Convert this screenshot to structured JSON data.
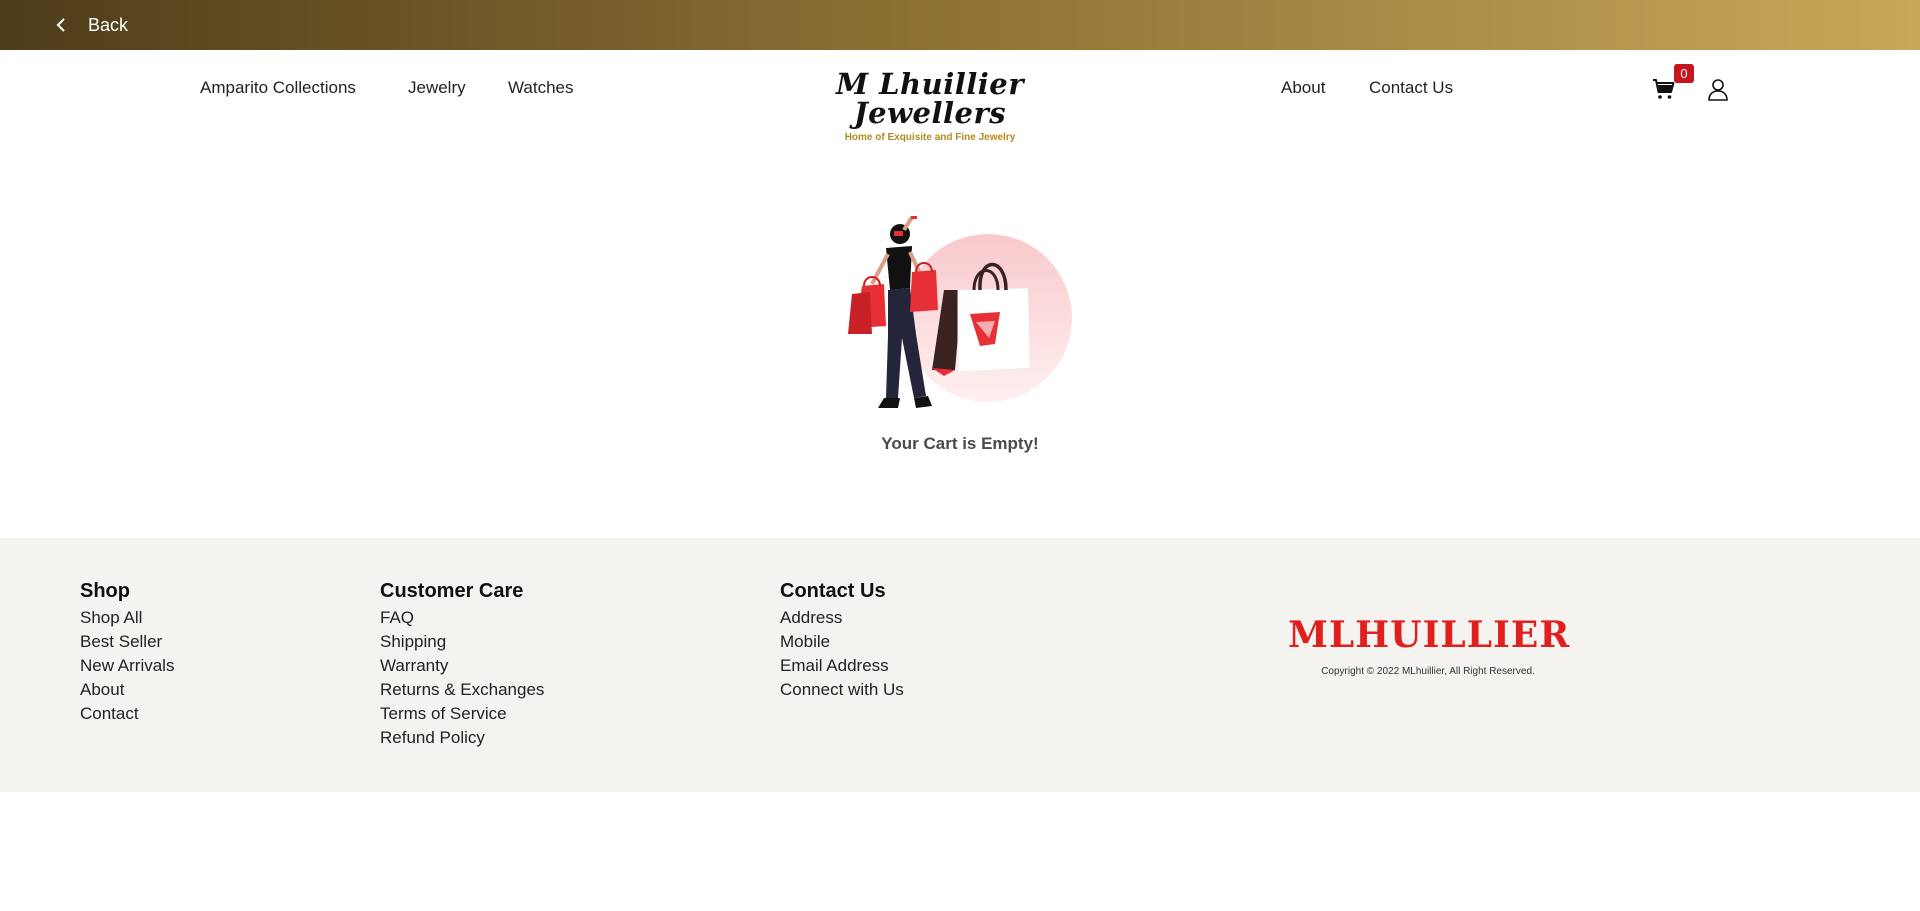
{
  "topbar": {
    "back_label": "Back"
  },
  "nav": {
    "left_links": [
      "Amparito Collections",
      "Jewelry",
      "Watches"
    ],
    "right_links": [
      "About",
      "Contact Us"
    ],
    "logo_text": "M Lhuillier Jewellers",
    "logo_tagline": "Home of Exquisite and Fine Jewelry",
    "cart_count": "0"
  },
  "main": {
    "empty_message": "Your Cart is Empty!"
  },
  "footer": {
    "shop": {
      "title": "Shop",
      "links": [
        "Shop All",
        "Best Seller",
        "New Arrivals",
        "About",
        "Contact"
      ]
    },
    "care": {
      "title": "Customer Care",
      "links": [
        "FAQ",
        "Shipping",
        "Warranty",
        "Returns & Exchanges",
        "Terms of Service",
        "Refund Policy"
      ]
    },
    "contact": {
      "title": "Contact Us",
      "links": [
        "Address",
        "Mobile",
        "Email Address",
        "Connect with Us"
      ]
    },
    "logo_text": "MLHUILLIER",
    "copyright": "Copyright © 2022 MLhuillier, All Right Reserved."
  },
  "colors": {
    "brand_red": "#e0201f",
    "gold_dark": "#4e3d1a",
    "gold_light": "#c9a85a",
    "footer_bg": "#f4f3ef"
  },
  "icons": {
    "back": "chevron-left-icon",
    "cart": "cart-icon",
    "user": "user-icon",
    "diamond": "diamond-icon"
  }
}
